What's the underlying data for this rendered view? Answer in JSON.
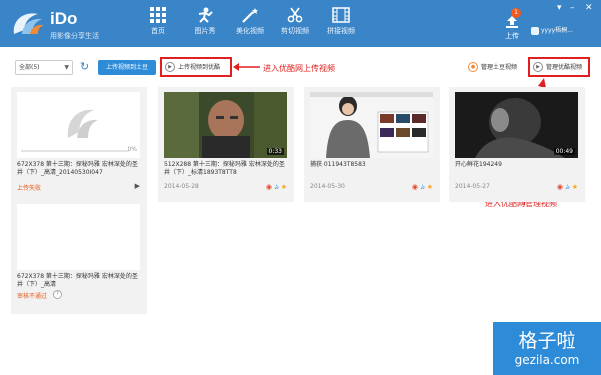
{
  "app": {
    "name": "iDo",
    "slogan": "用影像分享生活"
  },
  "nav": [
    {
      "label": "首页",
      "icon": "grid-icon"
    },
    {
      "label": "图片秀",
      "icon": "person-icon"
    },
    {
      "label": "美化视频",
      "icon": "magic-wand-icon"
    },
    {
      "label": "剪切视频",
      "icon": "scissors-icon"
    },
    {
      "label": "拼接视频",
      "icon": "film-icon"
    }
  ],
  "upload": {
    "label": "上传",
    "badge": "1"
  },
  "user": {
    "name": "yyyy梧桐..."
  },
  "toolbar": {
    "filter_value": "全部(5)",
    "upload_tudou": "上传视频到土豆",
    "upload_youku": "上传视频到优酷",
    "manage_tudou": "管理土豆视频",
    "manage_youku": "管理优酷视频"
  },
  "annotations": {
    "upload_youku": "进入优酷网上传视频",
    "manage_youku": "进入优酷网管理视频"
  },
  "cards": [
    {
      "title": "672X378 第十三期：探秘玛雅 宏林深处的圣井（下）_高清_20140530I047",
      "status": "上传失败",
      "progress": "0%"
    },
    {
      "title": "512X288 第十三期：探秘玛雅 宏林深处的圣井（下）_标清1893T8TT8",
      "date": "2014-05-28",
      "duration": "0:33"
    },
    {
      "title": "捕获 011943T8583",
      "date": "2014-05-30"
    },
    {
      "title": "开心鲜花194249",
      "date": "2014-05-27",
      "duration": "00:49"
    },
    {
      "title": "672X378 第十三期：探秘玛雅 宏林深处的圣井（下）_高清",
      "status": "审核不通过"
    }
  ],
  "watermark": {
    "cn": "格子啦",
    "en": "gezila.com"
  },
  "colors": {
    "header": "#3a84c8",
    "accent": "#2e8bd8",
    "annotation": "#e02020",
    "status": "#e55a1c"
  }
}
